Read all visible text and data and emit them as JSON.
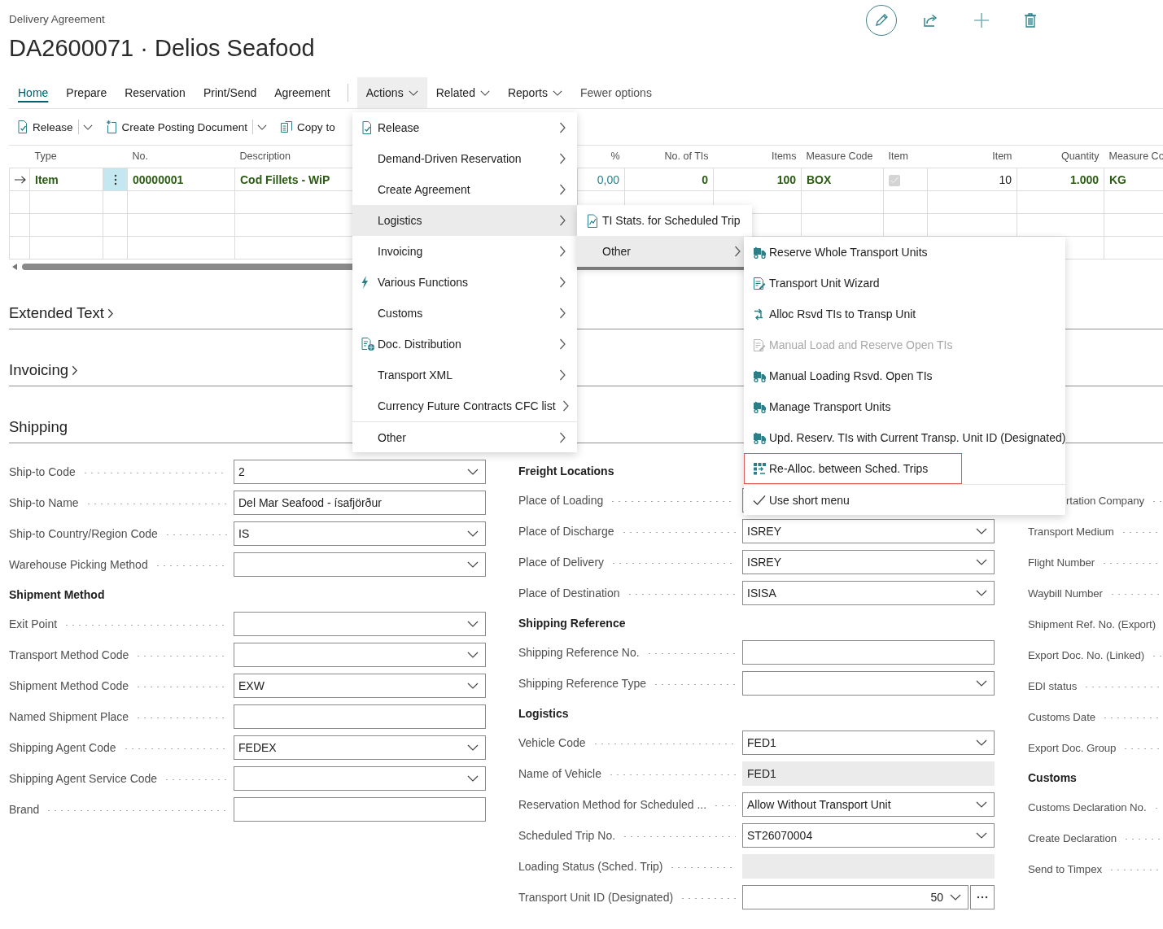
{
  "header": {
    "caption": "Delivery Agreement",
    "title": "DA2600071 · Delios Seafood"
  },
  "tabs": [
    {
      "label": "Home",
      "kind": "tab",
      "selected": true,
      "open": false
    },
    {
      "label": "Prepare",
      "kind": "tab",
      "selected": false,
      "open": false
    },
    {
      "label": "Reservation",
      "kind": "tab",
      "selected": false,
      "open": false
    },
    {
      "label": "Print/Send",
      "kind": "tab",
      "selected": false,
      "open": false
    },
    {
      "label": "Agreement",
      "kind": "tab",
      "selected": false,
      "open": false
    },
    {
      "label": "Actions",
      "kind": "menu",
      "selected": false,
      "open": true
    },
    {
      "label": "Related",
      "kind": "menu",
      "selected": false,
      "open": false
    },
    {
      "label": "Reports",
      "kind": "menu",
      "selected": false,
      "open": false
    },
    {
      "label": "Fewer options",
      "kind": "more",
      "selected": false,
      "open": false
    }
  ],
  "action_bar": [
    {
      "label": "Release",
      "split": true
    },
    {
      "label": "Create Posting Document",
      "split": true
    },
    {
      "label": "Copy to",
      "split": false
    }
  ],
  "lines": {
    "columns": [
      {
        "label": "Type"
      },
      {
        "label": "No."
      },
      {
        "label": "Description"
      },
      {
        "label": "%"
      },
      {
        "label": "No. of TIs"
      },
      {
        "label": "Items"
      },
      {
        "label": "Measure Code"
      },
      {
        "label": "Item"
      },
      {
        "label": "Item"
      },
      {
        "label": "Quantity"
      },
      {
        "label": "Measure Co"
      }
    ],
    "rows": [
      {
        "current": true,
        "selected": true,
        "cells": [
          {
            "kind": "strong",
            "text": "Item"
          },
          {
            "kind": "strong",
            "text": "00000001"
          },
          {
            "kind": "strong",
            "text": "Cod Fillets - WiP"
          },
          {
            "kind": "link",
            "text": "0,00"
          },
          {
            "kind": "strong",
            "text": "0"
          },
          {
            "kind": "strong",
            "text": "100"
          },
          {
            "kind": "strong",
            "text": "BOX"
          },
          {
            "kind": "checkbox",
            "checked": true,
            "disabled": true
          },
          {
            "kind": "text",
            "text": "10"
          },
          {
            "kind": "strong",
            "text": "1.000"
          },
          {
            "kind": "strong",
            "text": "KG"
          }
        ]
      }
    ]
  },
  "sections": [
    {
      "title": "Extended Text",
      "collapsed": true
    },
    {
      "title": "Invoicing",
      "collapsed": true
    },
    {
      "title": "Shipping",
      "collapsed": false,
      "columns": [
        [
          {
            "kind": "dropdown",
            "label": "Ship-to Code",
            "value": "2"
          },
          {
            "kind": "text",
            "label": "Ship-to Name",
            "value": "Del Mar Seafood - ísafjörður"
          },
          {
            "kind": "dropdown",
            "label": "Ship-to Country/Region Code",
            "value": "IS"
          },
          {
            "kind": "dropdown",
            "label": "Warehouse Picking Method"
          },
          {
            "kind": "heading",
            "label": "Shipment Method"
          },
          {
            "kind": "dropdown",
            "label": "Exit Point"
          },
          {
            "kind": "dropdown",
            "label": "Transport Method Code"
          },
          {
            "kind": "dropdown",
            "label": "Shipment Method Code",
            "value": "EXW"
          },
          {
            "kind": "text",
            "label": "Named Shipment Place"
          },
          {
            "kind": "dropdown",
            "label": "Shipping Agent Code",
            "value": "FEDEX"
          },
          {
            "kind": "dropdown",
            "label": "Shipping Agent Service Code"
          },
          {
            "kind": "text",
            "label": "Brand"
          }
        ],
        [
          {
            "kind": "heading",
            "label": "Freight Locations"
          },
          {
            "kind": "covered",
            "label": "Place of Loading"
          },
          {
            "kind": "dropdown",
            "label": "Place of Discharge",
            "value": "ISREY"
          },
          {
            "kind": "dropdown",
            "label": "Place of Delivery",
            "value": "ISREY"
          },
          {
            "kind": "dropdown",
            "label": "Place of Destination",
            "value": "ISISA"
          },
          {
            "kind": "heading",
            "label": "Shipping Reference"
          },
          {
            "kind": "text",
            "label": "Shipping Reference No."
          },
          {
            "kind": "dropdown",
            "label": "Shipping Reference Type"
          },
          {
            "kind": "heading",
            "label": "Logistics"
          },
          {
            "kind": "dropdown",
            "label": "Vehicle Code",
            "value": "FED1"
          },
          {
            "kind": "readonly",
            "label": "Name of Vehicle",
            "value": "FED1"
          },
          {
            "kind": "dropdown",
            "label": "Reservation Method for Scheduled ...",
            "value": "Allow Without Transport Unit"
          },
          {
            "kind": "dropdown",
            "label": "Scheduled Trip No.",
            "value": "ST26070004"
          },
          {
            "kind": "readonly",
            "label": "Loading Status (Sched. Trip)"
          },
          {
            "kind": "lookup",
            "label": "Transport Unit ID (Designated)",
            "value": "50"
          }
        ],
        [
          {
            "kind": "spacer"
          },
          {
            "kind": "clipped",
            "label": "rtation Company"
          },
          {
            "kind": "label",
            "label": "Transport Medium"
          },
          {
            "kind": "label",
            "label": "Flight Number"
          },
          {
            "kind": "label",
            "label": "Waybill Number"
          },
          {
            "kind": "label",
            "label": "Shipment Ref. No. (Export)"
          },
          {
            "kind": "label",
            "label": "Export Doc. No. (Linked)"
          },
          {
            "kind": "label",
            "label": "EDI status"
          },
          {
            "kind": "label",
            "label": "Customs Date"
          },
          {
            "kind": "label",
            "label": "Export Doc. Group"
          },
          {
            "kind": "heading",
            "label": "Customs"
          },
          {
            "kind": "label",
            "label": "Customs Declaration No."
          },
          {
            "kind": "label",
            "label": "Create Declaration"
          },
          {
            "kind": "label",
            "label": "Send to Timpex"
          }
        ]
      ]
    }
  ],
  "menus": [
    {
      "items": [
        {
          "label": "Release",
          "kind": "release",
          "selected": false,
          "submenu": true,
          "divider": false
        },
        {
          "label": "Demand-Driven Reservation",
          "kind": "plain",
          "selected": false,
          "submenu": true,
          "divider": false
        },
        {
          "label": "Create Agreement",
          "kind": "plain",
          "selected": false,
          "submenu": true,
          "divider": false
        },
        {
          "label": "Logistics",
          "kind": "plain",
          "selected": true,
          "submenu": true,
          "divider": false
        },
        {
          "label": "Invoicing",
          "kind": "plain",
          "selected": false,
          "submenu": true,
          "divider": false
        },
        {
          "label": "Various Functions",
          "kind": "functions",
          "selected": false,
          "submenu": true,
          "divider": false
        },
        {
          "label": "Customs",
          "kind": "plain",
          "selected": false,
          "submenu": true,
          "divider": false
        },
        {
          "label": "Doc. Distribution",
          "kind": "distribution",
          "selected": false,
          "submenu": true,
          "divider": false
        },
        {
          "label": "Transport XML",
          "kind": "plain",
          "selected": false,
          "submenu": true,
          "divider": false
        },
        {
          "label": "Currency Future Contracts CFC list",
          "kind": "plain",
          "selected": false,
          "submenu": true,
          "divider": false
        },
        {
          "label": "Other",
          "kind": "plain",
          "selected": false,
          "submenu": true,
          "divider": true
        }
      ]
    },
    {
      "items": [
        {
          "label": "TI Stats. for Scheduled Trip",
          "kind": "stats",
          "selected": false,
          "submenu": false
        },
        {
          "label": "Other",
          "kind": "plain",
          "selected": true,
          "submenu": true
        }
      ]
    },
    {
      "items": [
        {
          "label": "Reserve Whole Transport Units",
          "kind": "truck",
          "disabled": false,
          "focused": false
        },
        {
          "label": "Transport Unit Wizard",
          "kind": "wizard",
          "disabled": false,
          "focused": false
        },
        {
          "label": "Alloc Rsvd TIs to Transp Unit",
          "kind": "alloc",
          "disabled": false,
          "focused": false
        },
        {
          "label": "Manual Load and Reserve Open TIs",
          "kind": "wizard",
          "disabled": true,
          "focused": false
        },
        {
          "label": "Manual Loading Rsvd. Open TIs",
          "kind": "truck",
          "disabled": false,
          "focused": false
        },
        {
          "label": "Manage Transport Units",
          "kind": "truck",
          "disabled": false,
          "focused": false
        },
        {
          "label": "Upd. Reserv. TIs with Current Transp. Unit ID (Designated)",
          "kind": "truck",
          "disabled": false,
          "focused": false
        },
        {
          "label": "Re-Alloc. between Sched. Trips",
          "kind": "grid",
          "disabled": false,
          "focused": true
        }
      ],
      "short_menu": {
        "label": "Use short menu",
        "checked": true
      }
    }
  ]
}
